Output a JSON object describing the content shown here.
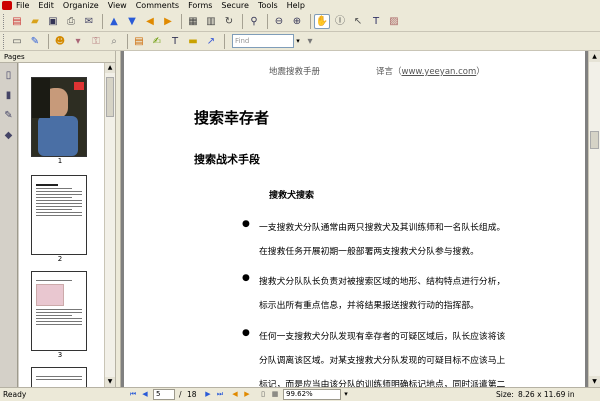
{
  "menu": [
    "File",
    "Edit",
    "Organize",
    "View",
    "Comments",
    "Forms",
    "Secure",
    "Tools",
    "Help"
  ],
  "toolbar": {
    "find_placeholder": "Find",
    "icons": [
      "new-document-icon",
      "open-folder-icon",
      "save-icon",
      "print-icon",
      "email-icon",
      "previous-page-icon",
      "next-page-icon",
      "back-icon",
      "forward-icon",
      "zoom-icon",
      "zoom-out-icon",
      "zoom-in-icon",
      "hand-tool-icon",
      "select-text-icon",
      "snapshot-icon",
      "typewriter-icon",
      "image-icon",
      "comment-icon",
      "highlight-icon",
      "arrow-icon"
    ]
  },
  "panel": {
    "title": "Pages",
    "thumb_numbers": [
      "1",
      "2",
      "3"
    ]
  },
  "document": {
    "header_left": "地震搜救手册",
    "header_right_prefix": "译言（",
    "header_link": "www.yeeyan.com",
    "header_right_suffix": "）",
    "title": "搜索幸存者",
    "section": "搜索战术手段",
    "subsection": "搜救犬搜索",
    "bullets": [
      {
        "lines": [
          "一支搜救犬分队通常由两只搜救犬及其训练师和一名队长组成。",
          "在搜救任务开展初期一般部署两支搜救犬分队参与搜救。"
        ]
      },
      {
        "lines": [
          "搜救犬分队队长负责对被搜索区域的地形、结构特点进行分析，",
          "标示出所有重点信息，并将结果报送搜救行动的指挥部。"
        ]
      },
      {
        "lines": [
          "任何一支搜救犬分队发现有幸存者的可疑区域后，队长应该将该",
          "分队调离该区域。对某支搜救犬分队发现的可疑目标不应该马上",
          "标记，而是应当由该分队的训练师明确标记地点，同时派遣第二"
        ]
      }
    ]
  },
  "status": {
    "ready": "Ready",
    "page_current": "5",
    "page_total": "18",
    "zoom": "99.62%",
    "size_label": "Size:",
    "size_value": "8.26 x 11.69 in"
  }
}
